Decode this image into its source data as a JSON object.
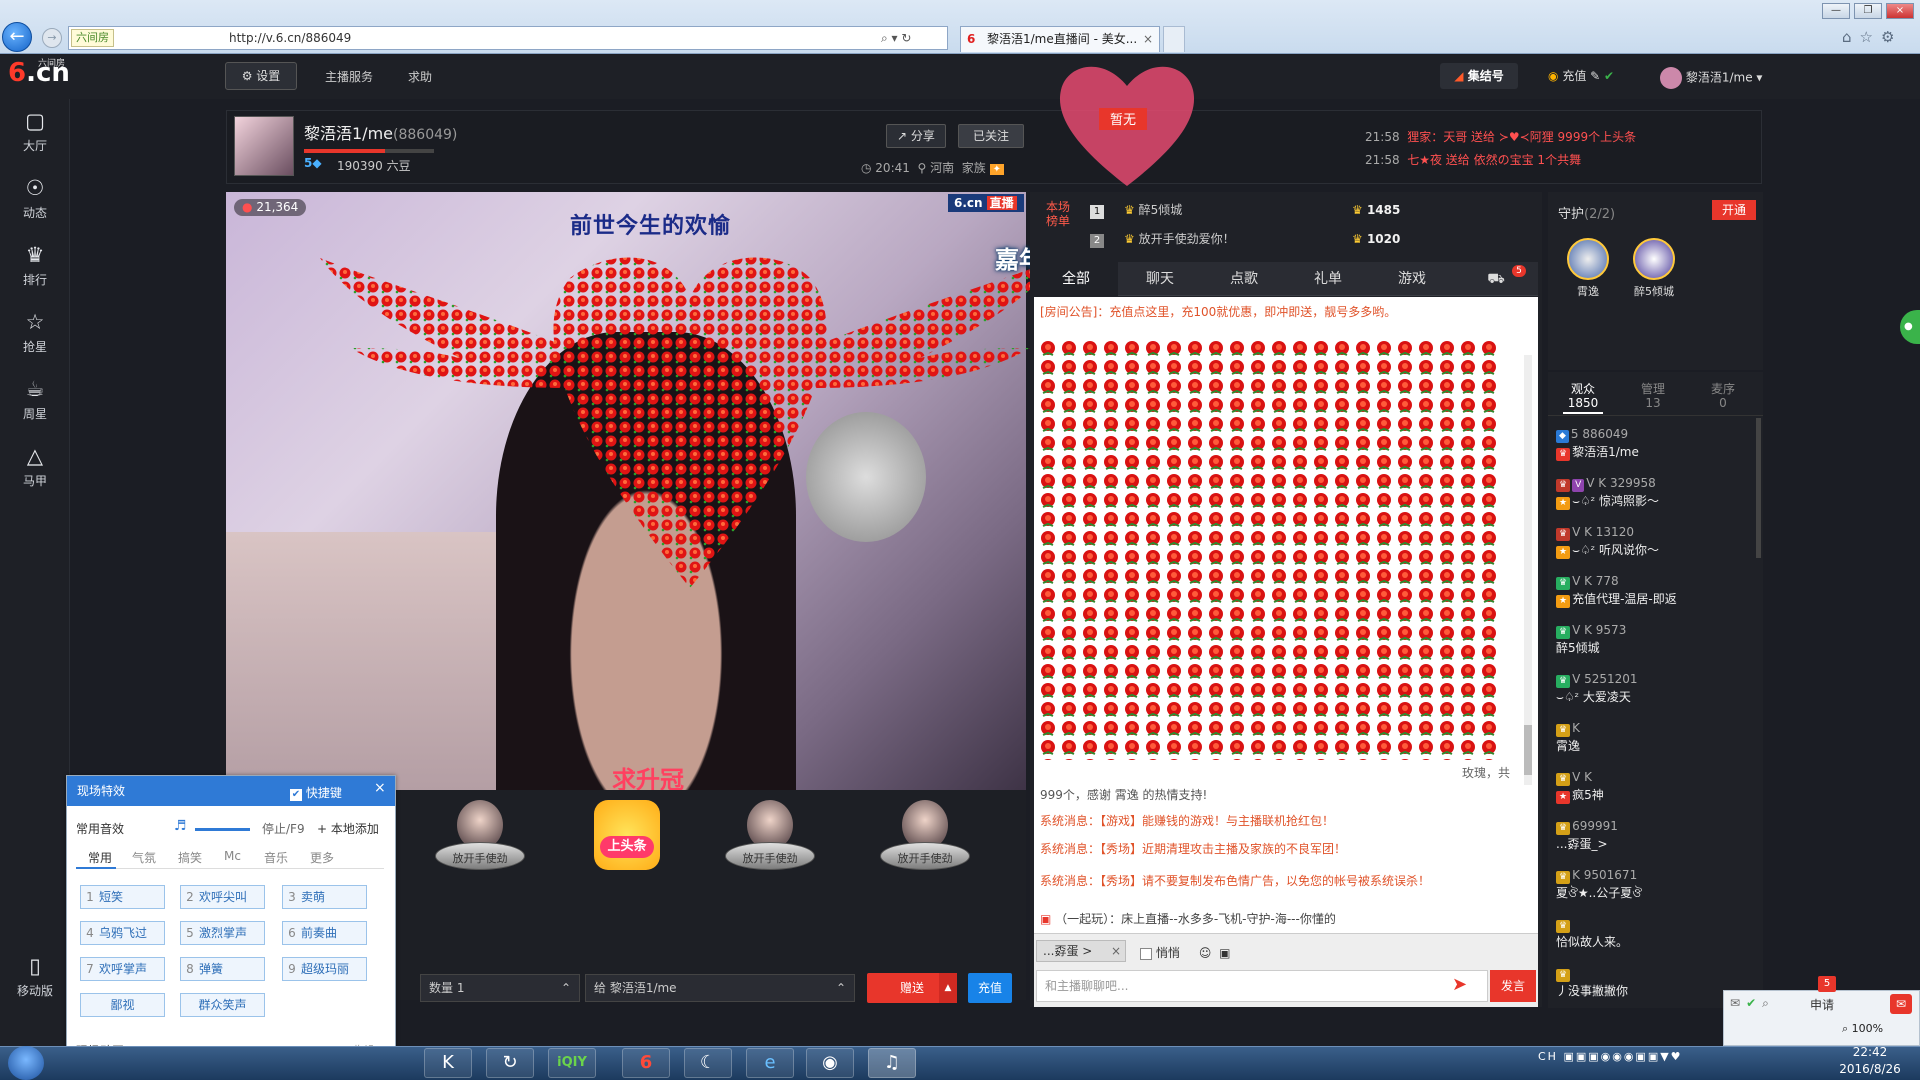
{
  "browser": {
    "site_badge": "六间房",
    "url": "http://v.6.cn/886049",
    "tab_title": "黎浯浯1/me直播间 - 美女...",
    "window_buttons": [
      "minimize",
      "restore",
      "close"
    ]
  },
  "header": {
    "logo_text": ".cn",
    "logo_sub": "六间房",
    "settings_label": "设置",
    "host_service": "主播服务",
    "help": "求助",
    "gather_label": "集结号",
    "recharge": "充值",
    "username": "黎浯浯1/me"
  },
  "leftnav": {
    "items": [
      {
        "label": "大厅",
        "icon": "tv-icon"
      },
      {
        "label": "动态",
        "icon": "compass-icon"
      },
      {
        "label": "排行",
        "icon": "crown-icon"
      },
      {
        "label": "抢星",
        "icon": "star-icon"
      },
      {
        "label": "周星",
        "icon": "cup-icon"
      },
      {
        "label": "马甲",
        "icon": "shirt-icon"
      }
    ],
    "mobile": "移动版"
  },
  "room": {
    "anchor_name": "黎浯浯1/me",
    "anchor_id": "(886049)",
    "level": "5",
    "beans": "190390 六豆",
    "share": "分享",
    "followed": "已关注",
    "time": "20:41",
    "location": "河南",
    "family": "家族",
    "tag": "暂无",
    "notices": [
      {
        "time": "21:58",
        "text": "狸家：天哥 送给 ≻♥≺阿狸 9999个上头条"
      },
      {
        "time": "21:58",
        "text": "七★夜 送给 依然の宝宝 1个共舞"
      }
    ]
  },
  "video": {
    "viewer_count": "21,364",
    "brand": "6.cn",
    "live": "直播",
    "overlay_title": "前世今生的欢愉",
    "carnival": "嘉年华歌舞升平",
    "seek_crown": "求升冠"
  },
  "gifts": {
    "items": [
      "放开手使劲",
      "上头条",
      "放开手使劲",
      "放开手使劲"
    ],
    "qty_label": "数量 1",
    "to_label": "给 黎浯浯1/me",
    "send": "赠送",
    "charge": "充值"
  },
  "rank": {
    "title": "本场榜单",
    "rows": [
      {
        "no": "1",
        "name": "醉5倾城",
        "score": "1485"
      },
      {
        "no": "2",
        "name": "放开手使劲爱你！",
        "score": "1020"
      }
    ]
  },
  "chat": {
    "tabs": [
      "全部",
      "聊天",
      "点歌",
      "礼单",
      "游戏"
    ],
    "car_badge": "5",
    "announcement": "[房间公告]：充值点这里，充100就优惠，即冲即送，靓号多多哟。",
    "rose_note": "玫瑰，共",
    "rose_thanks": "999个，感谢 霄逸 的热情支持!",
    "system_messages": [
      "系统消息：【游戏】能赚钱的游戏！与主播联机抢红包！",
      "系统消息：【秀场】近期清理攻击主播及家族的不良军团！",
      "系统消息：【秀场】请不要复制发布色情广告，以免您的帐号被系统误杀！"
    ],
    "game_line": "（一起玩）：床上直播--水多多-飞机-守护-海---你懂的",
    "mention": "...孬蛋 >",
    "quiet": "悄悄",
    "placeholder": "和主播聊聊吧...",
    "send": "发言"
  },
  "guard": {
    "title": "守护",
    "count": "(2/2)",
    "open": "开通",
    "members": [
      "霄逸",
      "醉5倾城"
    ]
  },
  "audience": {
    "tabs": [
      {
        "label": "观众",
        "count": "1850"
      },
      {
        "label": "管理",
        "count": "13"
      },
      {
        "label": "麦序",
        "count": "0"
      }
    ],
    "list": [
      {
        "badges": "5 886049",
        "name": "黎浯浯1/me"
      },
      {
        "badges": "V K 329958",
        "name": "⌣♤ᶻ 惊鸿照影～"
      },
      {
        "badges": "V K 13120",
        "name": "⌣♤ᶻ 听风说你～"
      },
      {
        "badges": "V K 778",
        "name": "充值代理-温居-即返"
      },
      {
        "badges": "V K 9573",
        "name": "醉5倾城"
      },
      {
        "badges": "V 5251201",
        "name": "⌣♤ᶻ 大爱凌天"
      },
      {
        "badges": "K",
        "name": "霄逸"
      },
      {
        "badges": "V K",
        "name": "疯5神"
      },
      {
        "badges": "699991",
        "name": "...孬蛋_>"
      },
      {
        "badges": "K 9501671",
        "name": "夏ঔ★..公子夏ঔ"
      },
      {
        "badges": "",
        "name": "恰似故人来。"
      },
      {
        "badges": "",
        "name": "丿没事撇撇你"
      }
    ]
  },
  "fx": {
    "title": "现场特效",
    "shortcut": "快捷键",
    "common_label": "常用音效",
    "stop": "停止/F9",
    "add_local": "本地添加",
    "tabs": [
      "常用",
      "气氛",
      "搞笑",
      "Mc",
      "音乐",
      "更多"
    ],
    "buttons": [
      {
        "k": "1",
        "label": "短笑"
      },
      {
        "k": "2",
        "label": "欢呼尖叫"
      },
      {
        "k": "3",
        "label": "卖萌"
      },
      {
        "k": "4",
        "label": "乌鸦飞过"
      },
      {
        "k": "5",
        "label": "激烈掌声"
      },
      {
        "k": "6",
        "label": "前奏曲"
      },
      {
        "k": "7",
        "label": "欢呼掌声"
      },
      {
        "k": "8",
        "label": "弹簧"
      },
      {
        "k": "9",
        "label": "超级玛丽"
      },
      {
        "k": "",
        "label": "鄙视"
      },
      {
        "k": "",
        "label": "群众笑声"
      }
    ],
    "anim_label": "现场动画",
    "fold": "收起"
  },
  "statusbar": {
    "apply": "申请",
    "badge": "5",
    "zoom": "100%"
  },
  "taskbar": {
    "time": "22:42",
    "date": "2016/8/26",
    "lang": "CH"
  }
}
